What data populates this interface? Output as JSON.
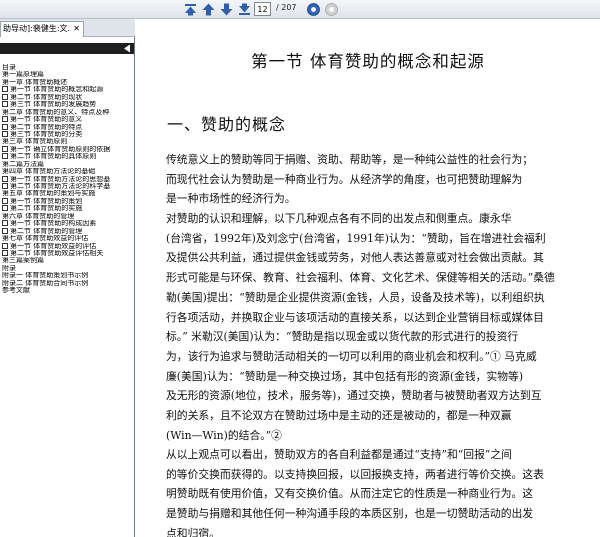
{
  "toolbar": {
    "page_number": "12",
    "page_total": "/ 207",
    "colors": {
      "nav_arrow": "#2f5fa8",
      "zoom_in": "#2f62b8",
      "zoom_out": "#b9b9b9"
    }
  },
  "tab": {
    "label": "助导动]:裴健生:文...",
    "close": "✕"
  },
  "sidebar": {
    "outline": [
      {
        "text": "目录",
        "checkbox": false
      },
      {
        "text": "第一篇原理篇",
        "checkbox": false
      },
      {
        "text": "第一章    体育赞助概述",
        "checkbox": false
      },
      {
        "text": "第一节    体育赞助的概念和起源",
        "checkbox": true
      },
      {
        "text": "第二节    体育赞助的现状",
        "checkbox": true
      },
      {
        "text": "第三节    体育赞助的发展趋势",
        "checkbox": true
      },
      {
        "text": "第二章    体育赞助的意义、特点及种",
        "checkbox": false
      },
      {
        "text": "第一节    体育赞助的意义",
        "checkbox": true
      },
      {
        "text": "第二节    体育赞助的特点",
        "checkbox": true
      },
      {
        "text": "第三节    体育赞助的分类",
        "checkbox": true
      },
      {
        "text": "第三章    体育赞助原则",
        "checkbox": false
      },
      {
        "text": "第一节    确立体育赞助原则的依据",
        "checkbox": true
      },
      {
        "text": "第二节    体育赞助的具体原则",
        "checkbox": true
      },
      {
        "text": "第二篇方法篇",
        "checkbox": false
      },
      {
        "text": "第四章    体育赞助方法论的基础",
        "checkbox": false
      },
      {
        "text": "第一节    体育赞助方法论的思想基",
        "checkbox": true
      },
      {
        "text": "第二节    体育赞助方法论的科学基",
        "checkbox": true
      },
      {
        "text": "第五章    体育赞助的策划与实施",
        "checkbox": false
      },
      {
        "text": "第一节    体育赞助的策划",
        "checkbox": true
      },
      {
        "text": "第二节    体育赞助的实施",
        "checkbox": true
      },
      {
        "text": "第六章    体育赞助的管理",
        "checkbox": false
      },
      {
        "text": "第一节    体育赞助的构成因素",
        "checkbox": true
      },
      {
        "text": "第二节    体育赞助的管理",
        "checkbox": true
      },
      {
        "text": "第七章    体育赞助效益的评估",
        "checkbox": false
      },
      {
        "text": "第一节    体育赞助效益的评估",
        "checkbox": true
      },
      {
        "text": "第二节    体育赞助效益评估相关",
        "checkbox": true
      },
      {
        "text": "第三篇案例篇",
        "checkbox": false
      },
      {
        "text": "附录",
        "checkbox": false
      },
      {
        "text": "附录一    体育赞助策划书示例",
        "checkbox": false
      },
      {
        "text": "附录二    体育赞助合同书示例",
        "checkbox": false
      },
      {
        "text": "参考文献",
        "checkbox": false
      }
    ]
  },
  "document": {
    "chapter_title": "第一节    体育赞助的概念和起源",
    "section_title": "一、赞助的概念",
    "p1": [
      "    传统意义上的赞助等同于捐赠、资助、帮助等，是一种纯公益性的社会行为；",
      "而现代社会认为赞助是一种商业行为。从经济学的角度，也可把赞助理解为",
      "是一种市场性的经济行为。"
    ],
    "p2": [
      "    对赞助的认识和理解，以下几种观点各有不同的出发点和侧重点。康永华",
      "(台湾省，1992年)及刘念宁(台湾省，1991年)认为：“赞助，旨在增进社会福利",
      "及提供公共利益，通过提供金钱或劳务，对他人表达善意或对社会做出贡献。其",
      "形式可能是与环保、教育、社会福利、体育、文化艺术、保健等相关的活动。”桑德",
      "勒(美国)提出：“赞助是企业提供资源(金钱，人员，设备及技术等)，以利组织执",
      "行各项活动，并换取企业与该项活动的直接关系，以达到企业营销目标或媒体目",
      "标。” 米勒汉(美国)认为：“赞助是指以现金或以货代款的形式进行的投资行",
      "为，该行为追求与赞助活动相关的一切可以利用的商业机会和权利。”① 马克威",
      "廉(美国)认为：“赞助是一种交换过场，其中包括有形的资源(金钱，实物等)",
      "及无形的资源(地位，技术，服务等)，通过交换，赞助者与被赞助者双方达到互",
      "利的关系，且不论双方在赞助过场中是主动的还是被动的，都是一种双赢",
      "(Win—Win)的结合。”②"
    ],
    "p3": [
      "    从以上观点可以看出，赞助双方的各自利益都是通过“支持”和“回报”之间",
      "的等价交换而获得的。以支持换回报，以回报换支持，两者进行等价交换。这表",
      "明赞助既有使用价值，又有交换价值。从而注定它的性质是一种商业行为。这",
      "是赞助与捐赠和其他任何一种沟通手段的本质区别，也是一切赞助活动的出发",
      "点和归宿。"
    ]
  }
}
